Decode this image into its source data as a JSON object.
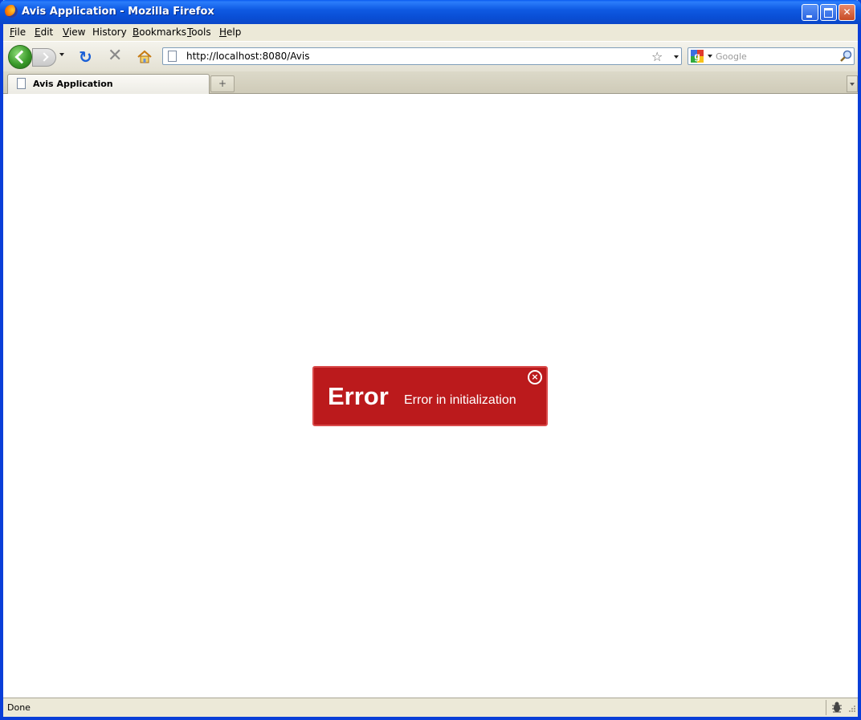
{
  "window": {
    "title": "Avis Application - Mozilla Firefox",
    "controls": {
      "minimize": "",
      "maximize": "",
      "close": "✕"
    }
  },
  "menu": {
    "items": [
      {
        "label": "File",
        "accel": "F",
        "rest": "ile"
      },
      {
        "label": "Edit",
        "accel": "E",
        "rest": "dit"
      },
      {
        "label": "View",
        "accel": "V",
        "rest": "iew"
      },
      {
        "label": "History",
        "accel": "",
        "rest": "History"
      },
      {
        "label": "Bookmarks",
        "accel": "B",
        "rest": "ookmarks"
      },
      {
        "label": "Tools",
        "accel": "T",
        "rest": "ools"
      },
      {
        "label": "Help",
        "accel": "H",
        "rest": "elp"
      }
    ]
  },
  "navigation": {
    "url": "http://localhost:8080/Avis",
    "search_placeholder": "Google",
    "reload_glyph": "↻",
    "stop_glyph": "✕",
    "star_glyph": "☆"
  },
  "tabs": {
    "active_label": "Avis Application",
    "new_tab_glyph": "+"
  },
  "error": {
    "title": "Error",
    "message": "Error in initialization",
    "close_glyph": "×"
  },
  "status": {
    "text": "Done"
  },
  "colors": {
    "error_bg": "#bb1a1c",
    "titlebar": "#0a4fd6"
  }
}
